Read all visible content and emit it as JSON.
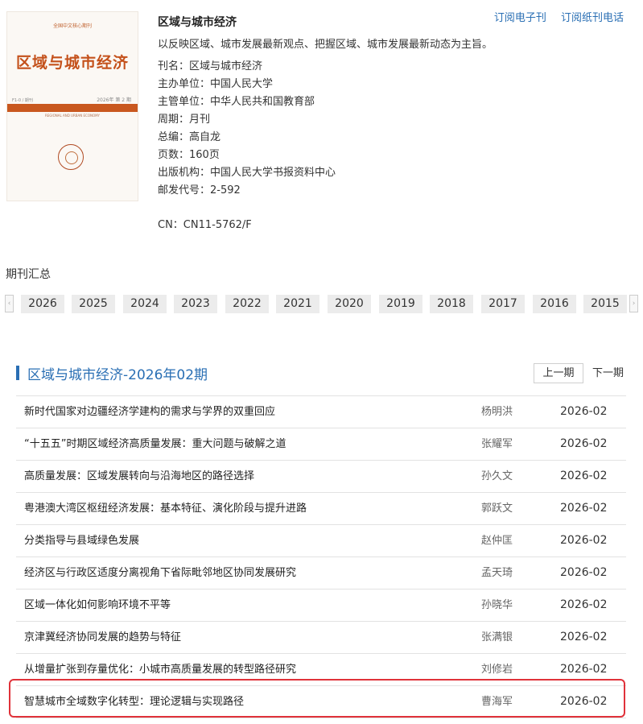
{
  "cover": {
    "top_small": "全国中文核心期刊",
    "title": "区域与城市经济",
    "band_left": "F1-0 / 期刊",
    "band_right": "2026年 第 2 期",
    "band_sub": "REGIONAL AND URBAN ECONOMY"
  },
  "journal": {
    "title": "区域与城市经济",
    "description": "以反映区域、城市发展最新观点、把握区域、城市发展最新动态为主旨。",
    "info": [
      "刊名：区域与城市经济",
      "主办单位：中国人民大学",
      "主管单位：中华人民共和国教育部",
      "周期：月刊",
      "总编：高自龙",
      "页数：160页",
      "出版机构：中国人民大学书报资料中心",
      "邮发代号：2-592"
    ],
    "cn": "CN：CN11-5762/F"
  },
  "top_links": {
    "subscribe_electronic": "订阅电子刊",
    "subscribe_paper_phone": "订阅纸刊电话"
  },
  "year_nav": {
    "heading": "期刊汇总",
    "left_arrow": "‹",
    "right_arrow": "›",
    "years": [
      "2026",
      "2025",
      "2024",
      "2023",
      "2022",
      "2021",
      "2020",
      "2019",
      "2018",
      "2017",
      "2016",
      "2015"
    ]
  },
  "issue": {
    "title": "区域与城市经济-2026年02期",
    "prev_label": "上一期",
    "next_label": "下一期",
    "articles": [
      {
        "title": "新时代国家对边疆经济学建构的需求与学界的双重回应",
        "author": "杨明洪",
        "date": "2026-02"
      },
      {
        "title": "“十五五”时期区域经济高质量发展：重大问题与破解之道",
        "author": "张耀军",
        "date": "2026-02"
      },
      {
        "title": "高质量发展：区域发展转向与沿海地区的路径选择",
        "author": "孙久文",
        "date": "2026-02"
      },
      {
        "title": "粤港澳大湾区枢纽经济发展：基本特征、演化阶段与提升进路",
        "author": "郭跃文",
        "date": "2026-02"
      },
      {
        "title": "分类指导与县域绿色发展",
        "author": "赵仲匡",
        "date": "2026-02"
      },
      {
        "title": "经济区与行政区适度分离视角下省际毗邻地区协同发展研究",
        "author": "孟天琦",
        "date": "2026-02"
      },
      {
        "title": "区域一体化如何影响环境不平等",
        "author": "孙晓华",
        "date": "2026-02"
      },
      {
        "title": "京津冀经济协同发展的趋势与特征",
        "author": "张满银",
        "date": "2026-02"
      },
      {
        "title": "从增量扩张到存量优化：小城市高质量发展的转型路径研究",
        "author": "刘修岩",
        "date": "2026-02"
      },
      {
        "title": "智慧城市全域数字化转型：理论逻辑与实现路径",
        "author": "曹海军",
        "date": "2026-02"
      }
    ]
  },
  "colors": {
    "link_blue": "#2a6fb4",
    "cover_orange": "#c4511b",
    "highlight_red": "#e0323a"
  }
}
